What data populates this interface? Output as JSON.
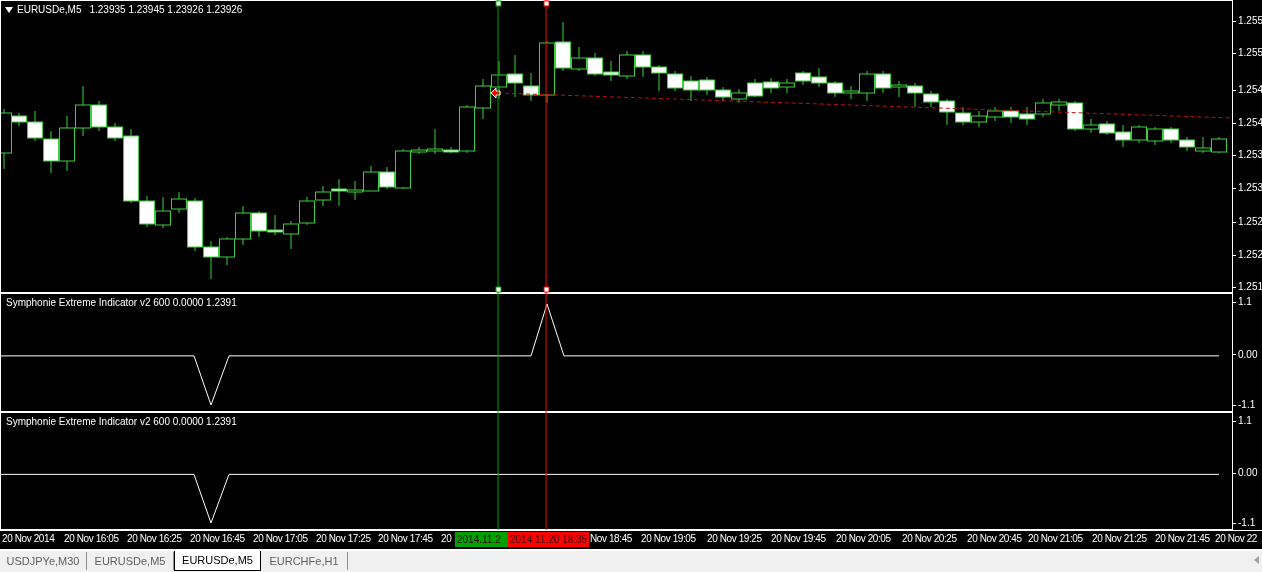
{
  "chart": {
    "symbol": "EURUSDe,M5",
    "quote": "1.23935 1.23945 1.23926 1.23926",
    "price_axis": [
      "1.255",
      "1.255",
      "1.254",
      "1.254",
      "1.253",
      "1.253",
      "1.252",
      "1.252",
      "1.251"
    ]
  },
  "indicators": [
    {
      "name": "Symphonie Extreme Indicator v2 600 0.0000 1.2391",
      "axis": [
        "1.1",
        "0.00",
        "-1.1"
      ]
    },
    {
      "name": "Symphonie Extreme Indicator v2 600 0.0000 1.2391",
      "axis": [
        "1.1",
        "0.00",
        "-1.1"
      ]
    }
  ],
  "time_axis": {
    "labels": [
      "20 Nov 2014",
      "20 Nov 16:05",
      "20 Nov 16:25",
      "20 Nov 16:45",
      "20 Nov 17:05",
      "20 Nov 17:25",
      "20 Nov 17:45",
      "20",
      "Nov 18:45",
      "20 Nov 19:05",
      "20 Nov 19:25",
      "20 Nov 19:45",
      "20 Nov 20:05",
      "20 Nov 20:25",
      "20 Nov 20:45",
      "20 Nov 21:05",
      "20 Nov 21:25",
      "20 Nov 21:45",
      "20 Nov 22"
    ],
    "markers": [
      {
        "text": "2014.11.2",
        "color": "#00a000"
      },
      {
        "text": "2014.11.20 18:35",
        "color": "#ff0000"
      }
    ]
  },
  "tabs": [
    {
      "label": "USDJPYe,M30",
      "selected": false
    },
    {
      "label": "EURUSDe,M5",
      "selected": false
    },
    {
      "label": "EURUSDe,M5",
      "selected": true
    },
    {
      "label": "EURCHFe,H1",
      "selected": false
    }
  ]
}
